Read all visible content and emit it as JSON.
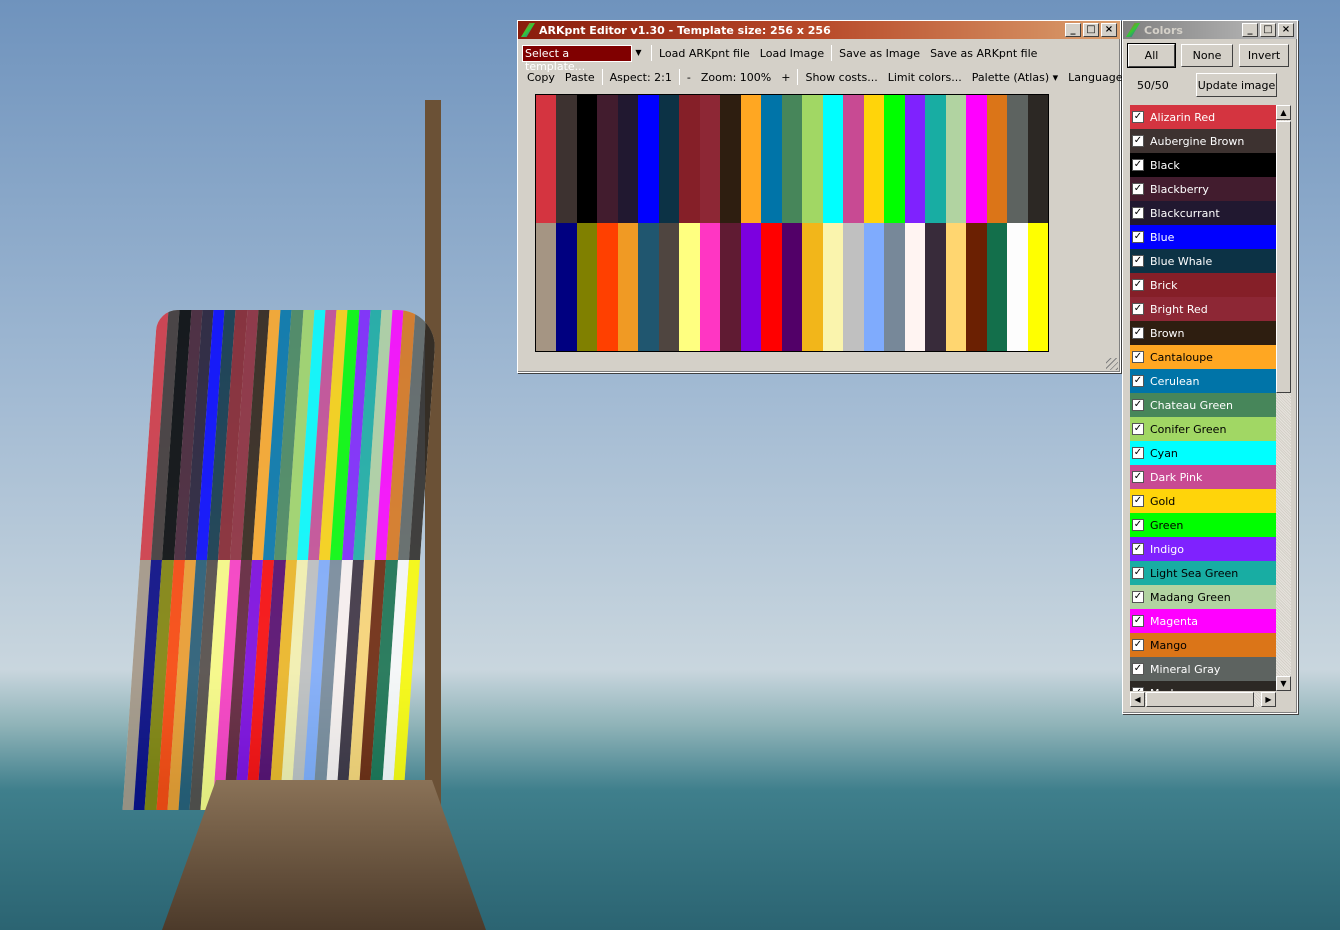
{
  "editor": {
    "title": "ARKpnt Editor v1.30 - Template size: 256 x 256",
    "template_select": "Select a template...",
    "toolbar1": [
      "Load ARKpnt file",
      "Load Image",
      "Save as Image",
      "Save as ARKpnt file"
    ],
    "copy": "Copy",
    "paste": "Paste",
    "aspect": "Aspect: 2:1",
    "zoom_out": "-",
    "zoom": "Zoom: 100%",
    "zoom_in": "+",
    "show_costs": "Show costs...",
    "limit_colors": "Limit colors...",
    "palette": "Palette (Atlas)",
    "language": "Language",
    "accent": "#800000",
    "palette_rows": [
      [
        "#d43440",
        "#3d3230",
        "#000000",
        "#421c2e",
        "#211830",
        "#0000ff",
        "#0c3245",
        "#851f28",
        "#8d2735",
        "#2e1e10",
        "#ffa722",
        "#0074a8",
        "#47865a",
        "#a1d764",
        "#00ffff",
        "#c84a93",
        "#ffd40a",
        "#00ff00",
        "#7f22fe",
        "#18ada3",
        "#b1d3a1",
        "#ff00ff",
        "#db7518",
        "#5d6360",
        "#2c2824"
      ],
      [
        "#a59583",
        "#000080",
        "#808000",
        "#ff4000",
        "#f09a24",
        "#20566f",
        "#4f4540",
        "#ffff80",
        "#ff36c3",
        "#601b33",
        "#7c00e0",
        "#ff0000",
        "#520068",
        "#f2b61a",
        "#faf4ad",
        "#c0c0c0",
        "#7fabfd",
        "#778899",
        "#fff4f2",
        "#382b3a",
        "#ffd670",
        "#6b2002",
        "#136f4b",
        "#fdfdfd",
        "#ffff00"
      ]
    ]
  },
  "colors": {
    "title": "Colors",
    "all": "All",
    "none": "None",
    "invert": "Invert",
    "count": "50/50",
    "update": "Update image",
    "items": [
      {
        "name": "Alizarin Red",
        "bg": "#d43440",
        "fg": "#fff"
      },
      {
        "name": "Aubergine Brown",
        "bg": "#3d3230",
        "fg": "#fff"
      },
      {
        "name": "Black",
        "bg": "#000000",
        "fg": "#fff"
      },
      {
        "name": "Blackberry",
        "bg": "#421c2e",
        "fg": "#fff"
      },
      {
        "name": "Blackcurrant",
        "bg": "#211830",
        "fg": "#fff"
      },
      {
        "name": "Blue",
        "bg": "#0000ff",
        "fg": "#fff"
      },
      {
        "name": "Blue Whale",
        "bg": "#0c3245",
        "fg": "#fff"
      },
      {
        "name": "Brick",
        "bg": "#851f28",
        "fg": "#fff"
      },
      {
        "name": "Bright Red",
        "bg": "#8d2735",
        "fg": "#fff"
      },
      {
        "name": "Brown",
        "bg": "#2e1e10",
        "fg": "#fff"
      },
      {
        "name": "Cantaloupe",
        "bg": "#ffa722",
        "fg": "#000"
      },
      {
        "name": "Cerulean",
        "bg": "#0074a8",
        "fg": "#fff"
      },
      {
        "name": "Chateau Green",
        "bg": "#47865a",
        "fg": "#fff"
      },
      {
        "name": "Conifer Green",
        "bg": "#a1d764",
        "fg": "#000"
      },
      {
        "name": "Cyan",
        "bg": "#00ffff",
        "fg": "#000"
      },
      {
        "name": "Dark Pink",
        "bg": "#c84a93",
        "fg": "#fff"
      },
      {
        "name": "Gold",
        "bg": "#ffd40a",
        "fg": "#000"
      },
      {
        "name": "Green",
        "bg": "#00ff00",
        "fg": "#000"
      },
      {
        "name": "Indigo",
        "bg": "#7f22fe",
        "fg": "#fff"
      },
      {
        "name": "Light Sea Green",
        "bg": "#18ada3",
        "fg": "#000"
      },
      {
        "name": "Madang Green",
        "bg": "#b1d3a1",
        "fg": "#000"
      },
      {
        "name": "Magenta",
        "bg": "#ff00ff",
        "fg": "#fff"
      },
      {
        "name": "Mango",
        "bg": "#db7518",
        "fg": "#000"
      },
      {
        "name": "Mineral Gray",
        "bg": "#5d6360",
        "fg": "#fff"
      },
      {
        "name": "Mud",
        "bg": "#2c2824",
        "fg": "#fff"
      }
    ]
  }
}
